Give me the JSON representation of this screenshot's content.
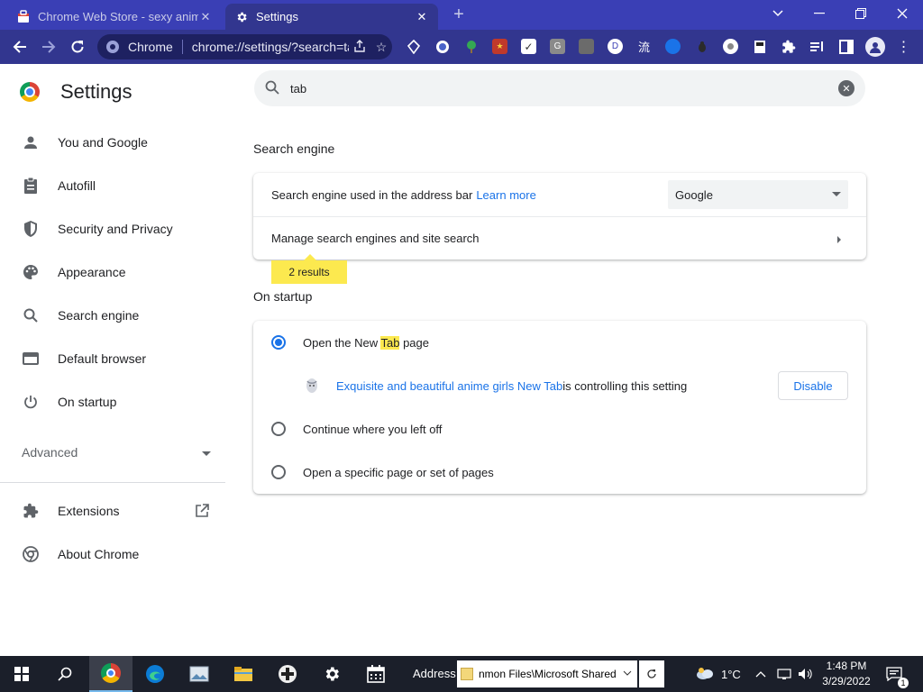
{
  "browser": {
    "tabs": [
      {
        "title": "Chrome Web Store - sexy anime",
        "active": false
      },
      {
        "title": "Settings",
        "active": true
      }
    ],
    "new_tab_symbol": "+",
    "window_controls": {
      "dropdown": "⌄",
      "minimize": "—",
      "restore": "❐",
      "close": "✕"
    },
    "omnibox": {
      "chip": "Chrome",
      "url": "chrome://settings/?search=tab"
    },
    "extensions": [
      "shield-ext",
      "circle-ext",
      "tree-ext",
      "puzzle-red-ext",
      "check-ext",
      "g-ext",
      "box-ext",
      "d-ext",
      "kanji-ext",
      "blue-ext",
      "bug-ext",
      "white-circle-ext",
      "bookmark-ext",
      "puzzle-ext",
      "media-ext",
      "sidepanel-ext",
      "profile",
      "menu"
    ]
  },
  "sidebar": {
    "title": "Settings",
    "items": [
      {
        "label": "You and Google",
        "icon": "person-icon"
      },
      {
        "label": "Autofill",
        "icon": "clipboard-icon"
      },
      {
        "label": "Security and Privacy",
        "icon": "shield-icon"
      },
      {
        "label": "Appearance",
        "icon": "palette-icon"
      },
      {
        "label": "Search engine",
        "icon": "search-icon"
      },
      {
        "label": "Default browser",
        "icon": "browser-icon"
      },
      {
        "label": "On startup",
        "icon": "power-icon"
      }
    ],
    "advanced": "Advanced",
    "bottom_items": [
      {
        "label": "Extensions",
        "icon": "puzzle-icon"
      },
      {
        "label": "About Chrome",
        "icon": "chrome-icon"
      }
    ]
  },
  "search": {
    "value": "tab"
  },
  "search_engine": {
    "title": "Search engine",
    "address_bar_label": "Search engine used in the address bar",
    "learn_more": "Learn more",
    "selected_engine": "Google",
    "manage_label": "Manage search engines and site search",
    "results_bubble": "2 results"
  },
  "on_startup": {
    "title": "On startup",
    "option1_prefix": "Open the New ",
    "option1_highlight": "Tab",
    "option1_suffix": " page",
    "extension_name": "Exquisite and beautiful anime girls New Tab",
    "controlling_text": " is controlling this setting",
    "disable_button": "Disable",
    "option2": "Continue where you left off",
    "option3": "Open a specific page or set of pages",
    "selected_option": 1
  },
  "taskbar": {
    "address_label": "Address",
    "address_value": "nmon Files\\Microsoft Shared",
    "temperature": "1°C",
    "time": "1:48 PM",
    "date": "3/29/2022"
  },
  "colors": {
    "titlebar": "#3a3fb5",
    "toolbar": "#32368f",
    "link": "#1a73e8",
    "highlight": "#fce94f",
    "taskbar": "#1b1f2a"
  }
}
